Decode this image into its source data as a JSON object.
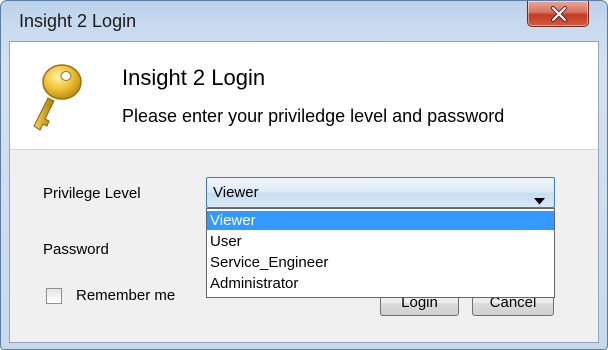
{
  "window": {
    "title": "Insight 2 Login"
  },
  "header": {
    "title": "Insight 2 Login",
    "subtitle": "Please enter your priviledge level and password"
  },
  "form": {
    "privilege_label": "Privilege Level",
    "privilege_value": "Viewer",
    "privilege_options": [
      "Viewer",
      "User",
      "Service_Engineer",
      "Administrator"
    ],
    "password_label": "Password",
    "remember_label": "Remember me",
    "remember_checked": false
  },
  "buttons": {
    "login": "Login",
    "cancel": "Cancel"
  },
  "icons": {
    "close": "close-icon",
    "key": "key-icon",
    "dropdown": "chevron-down-icon"
  },
  "colors": {
    "selection": "#3399ff",
    "close_button": "#c23b22"
  }
}
